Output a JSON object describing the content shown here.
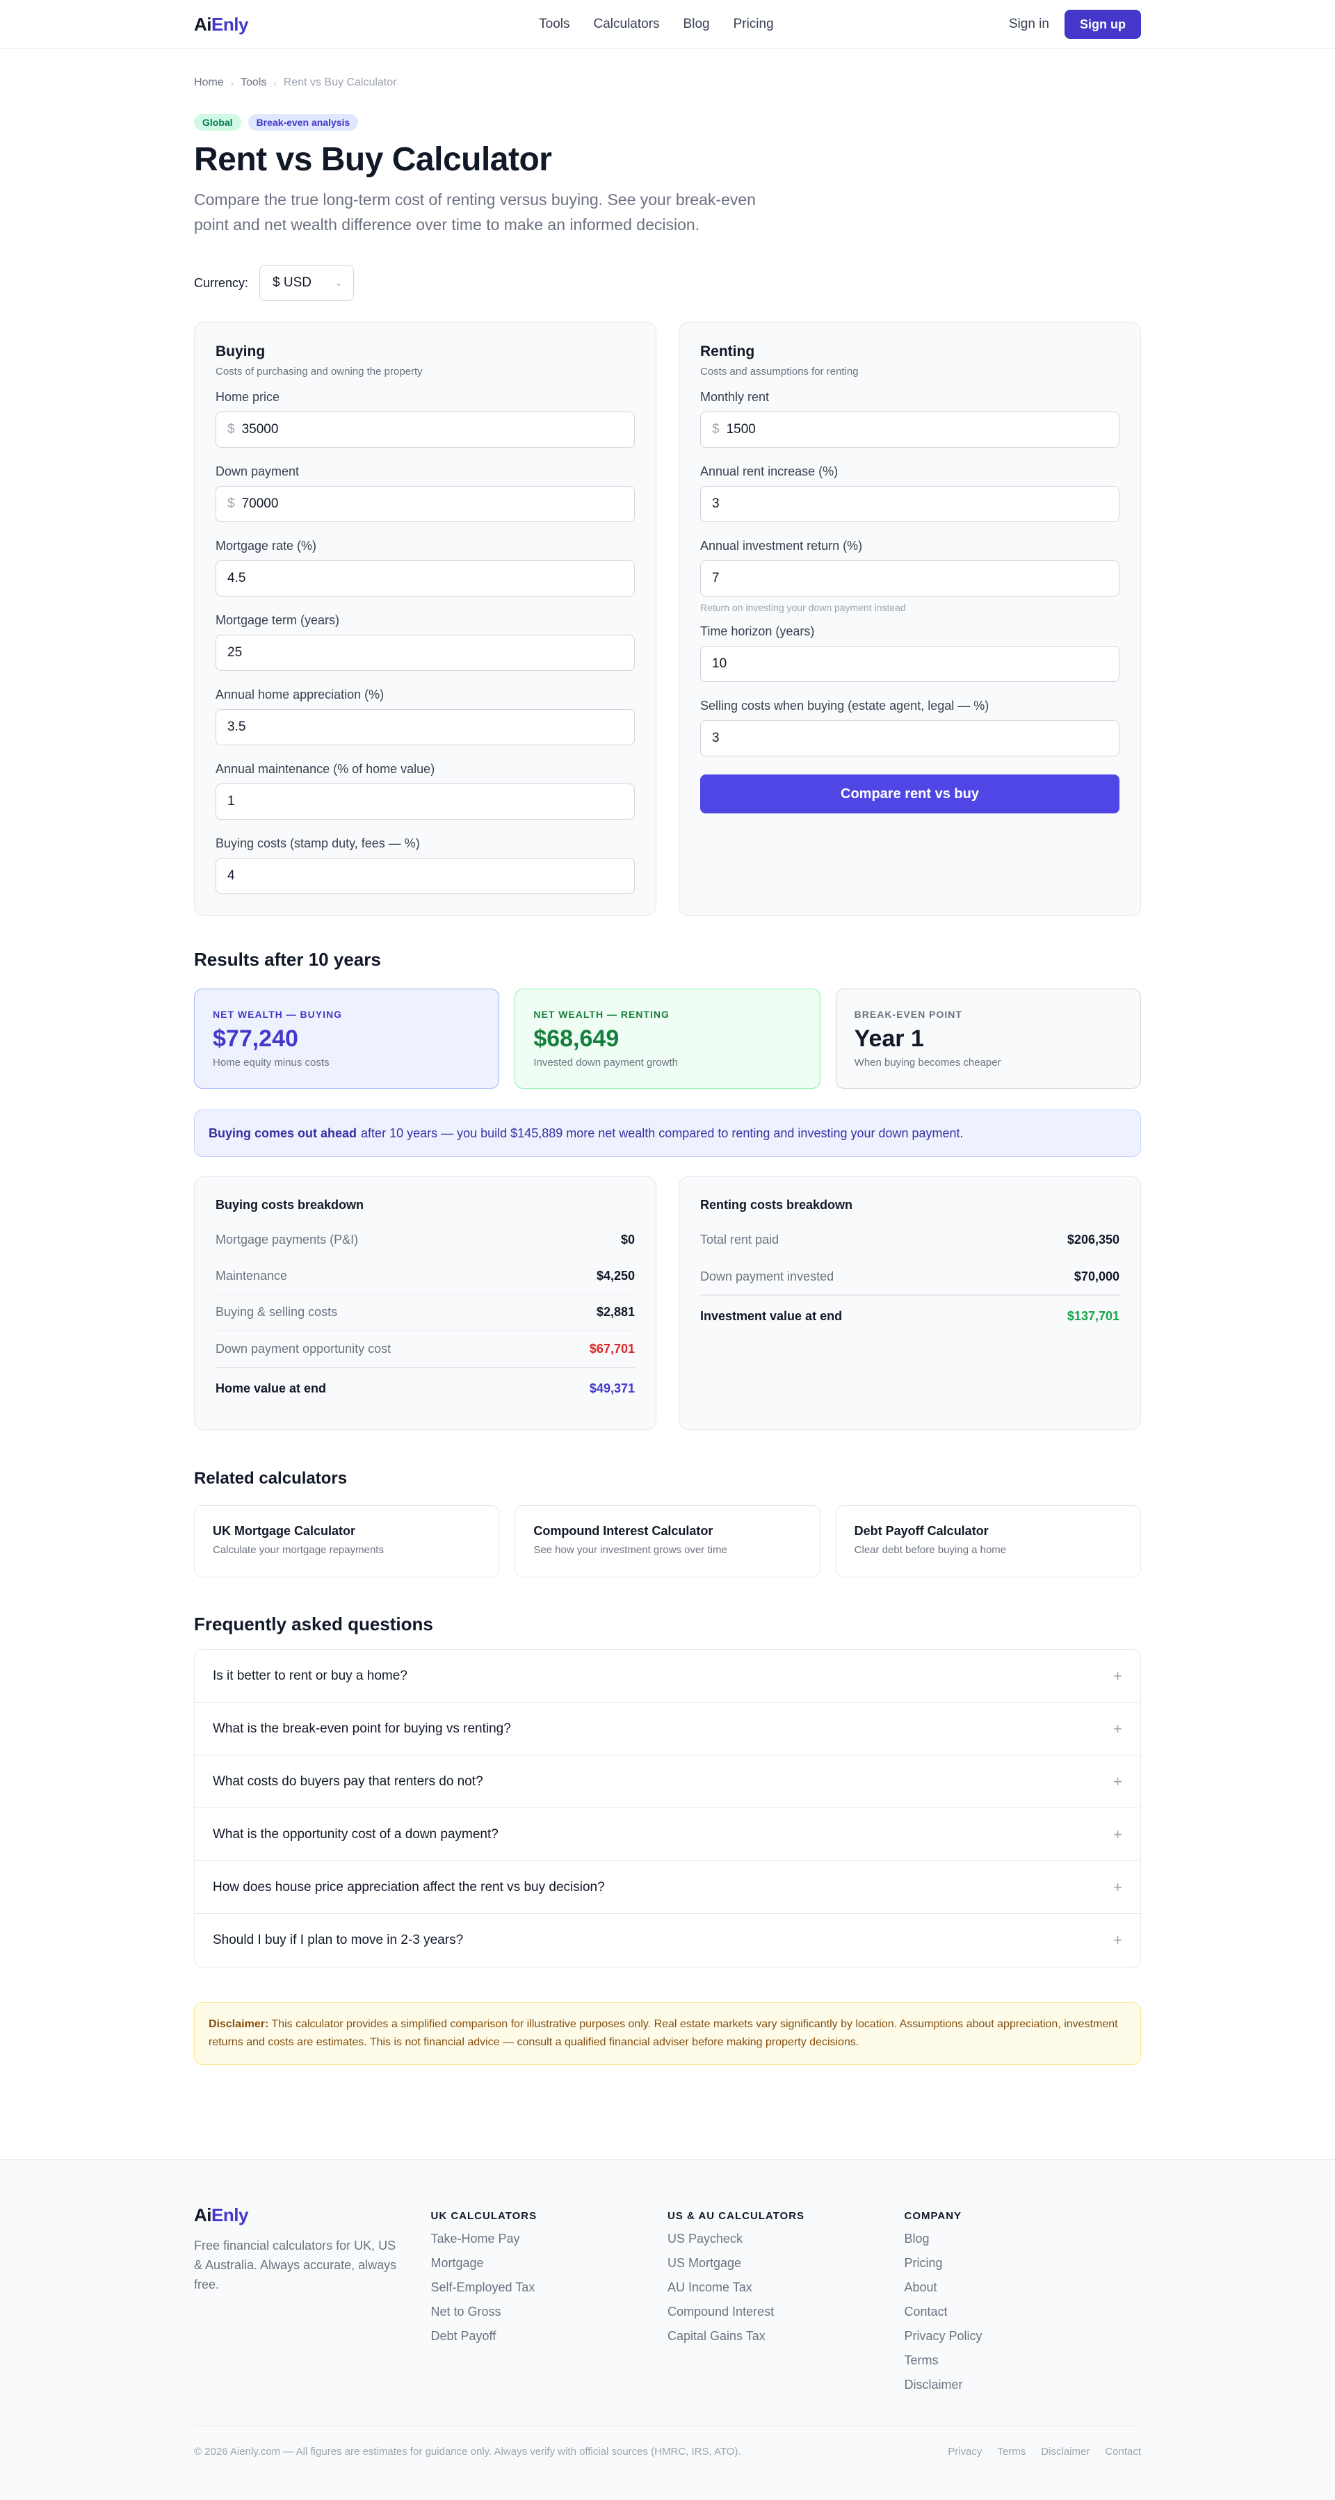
{
  "brand": {
    "part1": "Ai",
    "part2": "Enly"
  },
  "nav": {
    "items": [
      "Tools",
      "Calculators",
      "Blog",
      "Pricing"
    ],
    "signin": "Sign in",
    "signup": "Sign up"
  },
  "breadcrumb": [
    "Home",
    "Tools",
    "Rent vs Buy Calculator"
  ],
  "badges": [
    "Global",
    "Break-even analysis"
  ],
  "title": "Rent vs Buy Calculator",
  "subtitle": "Compare the true long-term cost of renting versus buying. See your break-even point and net wealth difference over time to make an informed decision.",
  "currency": {
    "label": "Currency:",
    "value": "$ USD"
  },
  "buying": {
    "title": "Buying",
    "desc": "Costs of purchasing and owning the property",
    "fields": [
      {
        "label": "Home price",
        "prefix": "$",
        "value": "35000"
      },
      {
        "label": "Down payment",
        "prefix": "$",
        "value": "70000"
      },
      {
        "label": "Mortgage rate (%)",
        "value": "4.5"
      },
      {
        "label": "Mortgage term (years)",
        "value": "25"
      },
      {
        "label": "Annual home appreciation (%)",
        "value": "3.5"
      },
      {
        "label": "Annual maintenance (% of home value)",
        "value": "1"
      },
      {
        "label": "Buying costs (stamp duty, fees — %)",
        "value": "4"
      }
    ]
  },
  "renting": {
    "title": "Renting",
    "desc": "Costs and assumptions for renting",
    "fields": [
      {
        "label": "Monthly rent",
        "prefix": "$",
        "value": "1500"
      },
      {
        "label": "Annual rent increase (%)",
        "value": "3"
      },
      {
        "label": "Annual investment return (%)",
        "value": "7",
        "hint": "Return on investing your down payment instead"
      },
      {
        "label": "Time horizon (years)",
        "value": "10"
      },
      {
        "label": "Selling costs when buying (estate agent, legal — %)",
        "value": "3"
      }
    ],
    "button": "Compare rent vs buy"
  },
  "results": {
    "title": "Results after 10 years",
    "cards": [
      {
        "label": "NET WEALTH — BUYING",
        "value": "$77,240",
        "note": "Home equity minus costs"
      },
      {
        "label": "NET WEALTH — RENTING",
        "value": "$68,649",
        "note": "Invested down payment growth"
      },
      {
        "label": "BREAK-EVEN POINT",
        "value": "Year 1",
        "note": "When buying becomes cheaper"
      }
    ],
    "banner_bold": "Buying comes out ahead",
    "banner_text": "after 10 years — you build $145,889 more net wealth compared to renting and investing your down payment."
  },
  "buying_breakdown": {
    "title": "Buying costs breakdown",
    "rows": [
      {
        "label": "Mortgage payments (P&I)",
        "value": "$0"
      },
      {
        "label": "Maintenance",
        "value": "$4,250"
      },
      {
        "label": "Buying & selling costs",
        "value": "$2,881"
      },
      {
        "label": "Down payment opportunity cost",
        "value": "$67,701"
      }
    ],
    "total_label": "Home value at end",
    "total_value": "$49,371"
  },
  "renting_breakdown": {
    "title": "Renting costs breakdown",
    "rows": [
      {
        "label": "Total rent paid",
        "value": "$206,350"
      },
      {
        "label": "Down payment invested",
        "value": "$70,000"
      }
    ],
    "total_label": "Investment value at end",
    "total_value": "$137,701"
  },
  "related": {
    "title": "Related calculators",
    "items": [
      {
        "title": "UK Mortgage Calculator",
        "desc": "Calculate your mortgage repayments"
      },
      {
        "title": "Compound Interest Calculator",
        "desc": "See how your investment grows over time"
      },
      {
        "title": "Debt Payoff Calculator",
        "desc": "Clear debt before buying a home"
      }
    ]
  },
  "faq": {
    "title": "Frequently asked questions",
    "items": [
      "Is it better to rent or buy a home?",
      "What is the break-even point for buying vs renting?",
      "What costs do buyers pay that renters do not?",
      "What is the opportunity cost of a down payment?",
      "How does house price appreciation affect the rent vs buy decision?",
      "Should I buy if I plan to move in 2-3 years?"
    ]
  },
  "disclaimer": {
    "bold": "Disclaimer:",
    "text": "This calculator provides a simplified comparison for illustrative purposes only. Real estate markets vary significantly by location. Assumptions about appreciation, investment returns and costs are estimates. This is not financial advice — consult a qualified financial adviser before making property decisions."
  },
  "footer": {
    "desc": "Free financial calculators for UK, US & Australia. Always accurate, always free.",
    "cols": [
      {
        "heading": "UK CALCULATORS",
        "links": [
          "Take-Home Pay",
          "Mortgage",
          "Self-Employed Tax",
          "Net to Gross",
          "Debt Payoff"
        ]
      },
      {
        "heading": "US & AU CALCULATORS",
        "links": [
          "US Paycheck",
          "US Mortgage",
          "AU Income Tax",
          "Compound Interest",
          "Capital Gains Tax"
        ]
      },
      {
        "heading": "COMPANY",
        "links": [
          "Blog",
          "Pricing",
          "About",
          "Contact",
          "Privacy Policy",
          "Terms",
          "Disclaimer"
        ]
      }
    ],
    "copyright": "© 2026 Aienly.com — All figures are estimates for guidance only. Always verify with official sources (HMRC, IRS, ATO).",
    "bottom_links": [
      "Privacy",
      "Terms",
      "Disclaimer",
      "Contact"
    ]
  },
  "colors": {
    "accent": "#4338ca",
    "button": "#4f46e5",
    "positive": "#16a34a",
    "negative": "#dc2626"
  }
}
